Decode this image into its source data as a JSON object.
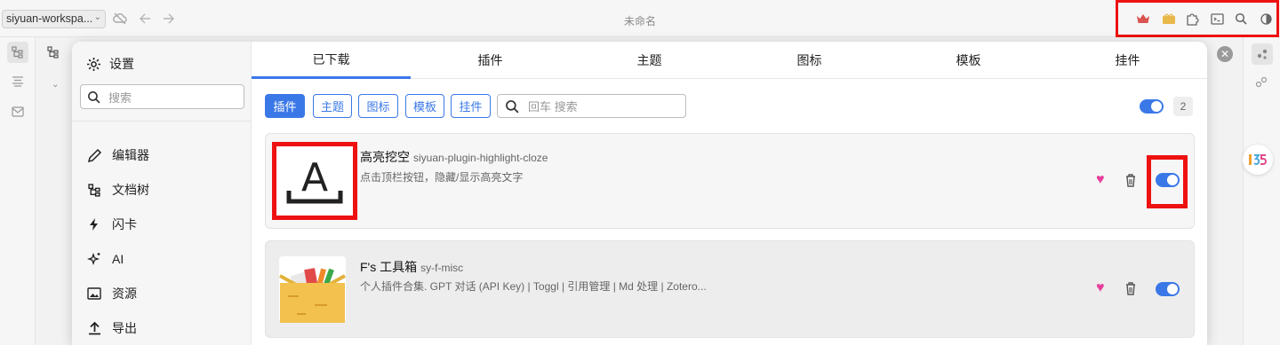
{
  "window": {
    "workspace": "siyuan-workspa...",
    "title": "未命名"
  },
  "topbar_right_icons": [
    "crown-icon",
    "vip-icon",
    "puzzle-icon",
    "terminal-icon",
    "search-icon",
    "theme-icon"
  ],
  "settings": {
    "title": "设置",
    "search_placeholder": "搜索",
    "nav": [
      {
        "label": "编辑器",
        "icon": "pencil-icon"
      },
      {
        "label": "文档树",
        "icon": "doctree-icon"
      },
      {
        "label": "闪卡",
        "icon": "flash-icon"
      },
      {
        "label": "AI",
        "icon": "sparkle-icon"
      },
      {
        "label": "资源",
        "icon": "image-icon"
      },
      {
        "label": "导出",
        "icon": "upload-icon"
      }
    ]
  },
  "tabs": [
    "已下载",
    "插件",
    "主题",
    "图标",
    "模板",
    "挂件"
  ],
  "active_tab": "已下载",
  "filters": {
    "chips": [
      "插件",
      "主题",
      "图标",
      "模板",
      "挂件"
    ],
    "active_chip": "插件",
    "search_placeholder": "回车 搜索",
    "count": "2"
  },
  "plugins": [
    {
      "name": "高亮挖空",
      "package": "siyuan-plugin-highlight-cloze",
      "description": "点击顶栏按钮，隐藏/显示高亮文字",
      "icon_letter": "A",
      "enabled": true
    },
    {
      "name": "F's 工具箱",
      "package": "sy-f-misc",
      "description": "个人插件合集. GPT 对话 (API Key) | Toggl | 引用管理 | Md 处理 | Zotero...",
      "enabled": true
    }
  ],
  "colors": {
    "accent": "#3b78e7",
    "highlight_box": "#ee1111",
    "heart": "#e63e9c"
  }
}
